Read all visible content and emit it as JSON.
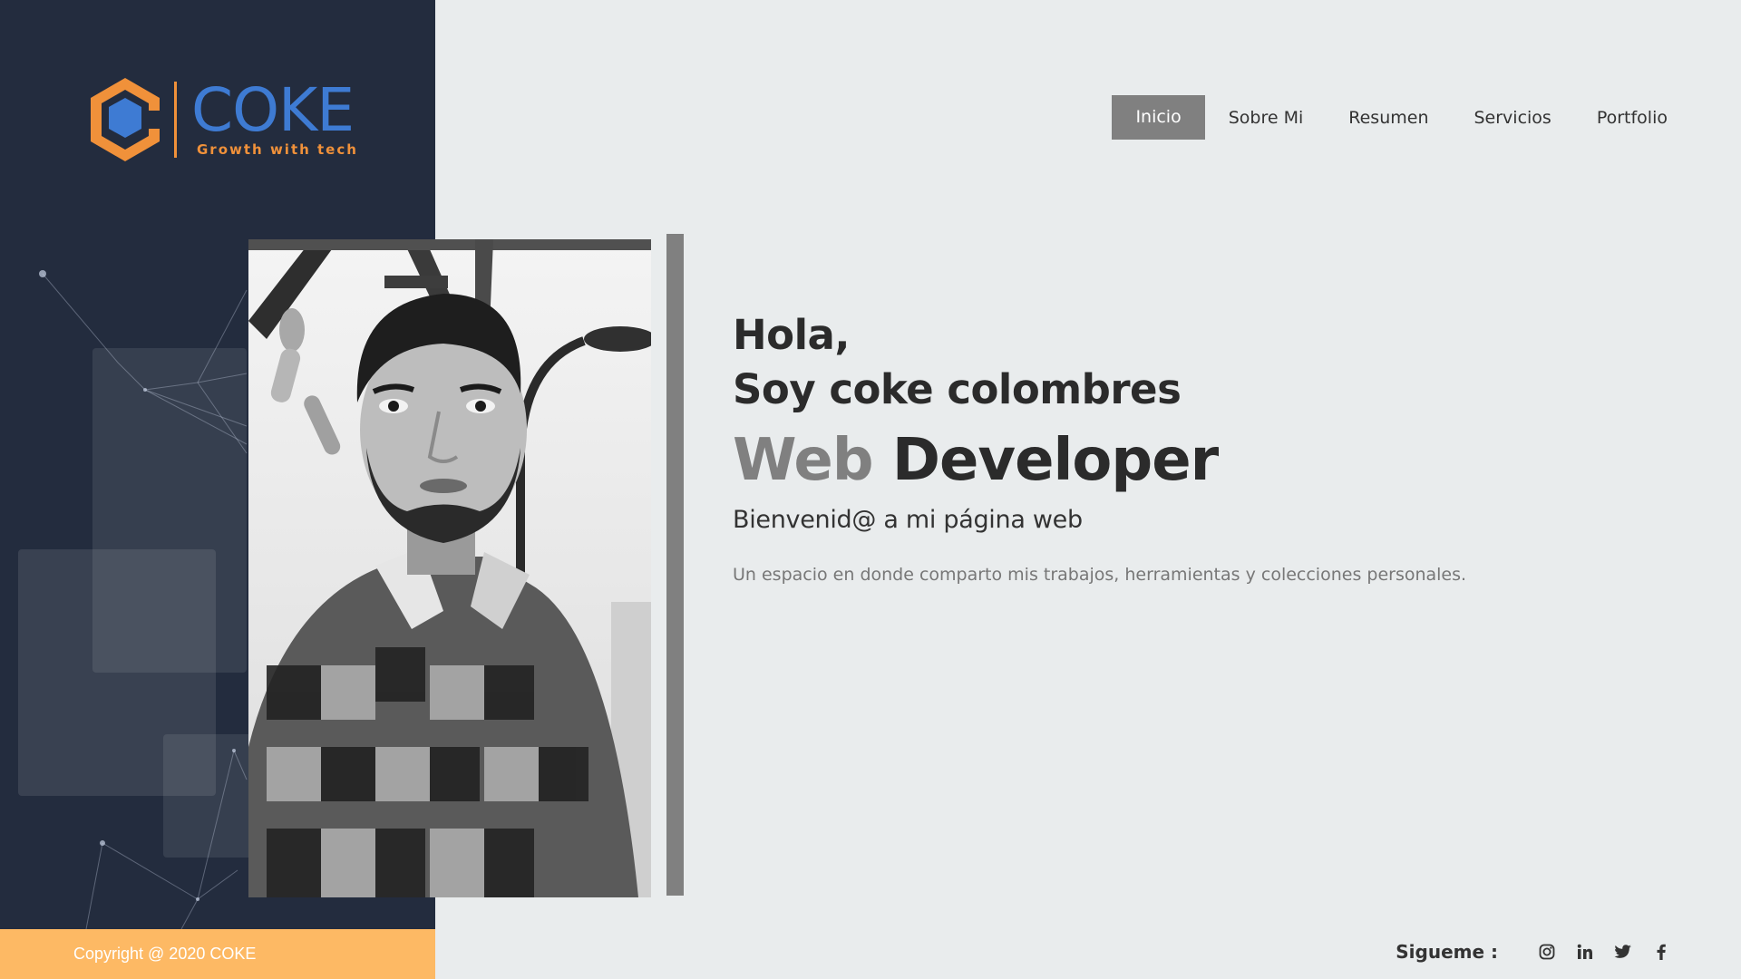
{
  "brand": {
    "name": "COKE",
    "tagline": "Growth with tech",
    "primary_color": "#3e7bd3",
    "accent_color": "#f0913a"
  },
  "nav": {
    "items": [
      {
        "label": "Inicio",
        "active": true
      },
      {
        "label": "Sobre Mi",
        "active": false
      },
      {
        "label": "Resumen",
        "active": false
      },
      {
        "label": "Servicios",
        "active": false
      },
      {
        "label": "Portfolio",
        "active": false
      }
    ]
  },
  "hero": {
    "greeting_line1": "Hola,",
    "greeting_line2": "Soy coke colombres",
    "role_word1": "Web",
    "role_word2": "Developer",
    "welcome": "Bienvenid@ a mi página web",
    "description": "Un espacio en donde comparto mis trabajos, herramientas y colecciones personales."
  },
  "footer": {
    "copyright": "Copyright @ 2020 COKE",
    "social_label": "Sigueme :",
    "social_icons": [
      "instagram-icon",
      "linkedin-icon",
      "twitter-icon",
      "facebook-icon"
    ]
  },
  "colors": {
    "sidebar_bg": "#232c3e",
    "page_bg": "#e9eced",
    "copyright_bg": "#fdb964",
    "nav_active_bg": "#808080"
  }
}
